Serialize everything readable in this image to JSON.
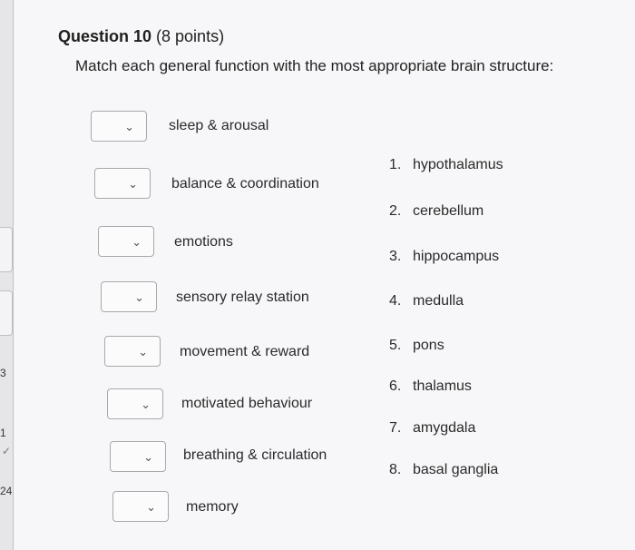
{
  "question": {
    "title_bold": "Question 10",
    "title_points": " (8 points)"
  },
  "prompt": "Match each general function with the most appropriate brain structure:",
  "items": [
    {
      "label": "sleep & arousal"
    },
    {
      "label": "balance & coordination"
    },
    {
      "label": "emotions"
    },
    {
      "label": "sensory relay station"
    },
    {
      "label": "movement & reward"
    },
    {
      "label": "motivated behaviour"
    },
    {
      "label": "breathing & circulation"
    },
    {
      "label": "memory"
    }
  ],
  "options": [
    {
      "num": "1.",
      "text": "hypothalamus"
    },
    {
      "num": "2.",
      "text": "cerebellum"
    },
    {
      "num": "3.",
      "text": "hippocampus"
    },
    {
      "num": "4.",
      "text": "medulla"
    },
    {
      "num": "5.",
      "text": "pons"
    },
    {
      "num": "6.",
      "text": "thalamus"
    },
    {
      "num": "7.",
      "text": "amygdala"
    },
    {
      "num": "8.",
      "text": "basal ganglia"
    }
  ],
  "side": {
    "n1": "3",
    "n2": "1",
    "n3": "24"
  },
  "icons": {
    "dropdown": "chevron-down-icon",
    "check": "check-icon"
  }
}
